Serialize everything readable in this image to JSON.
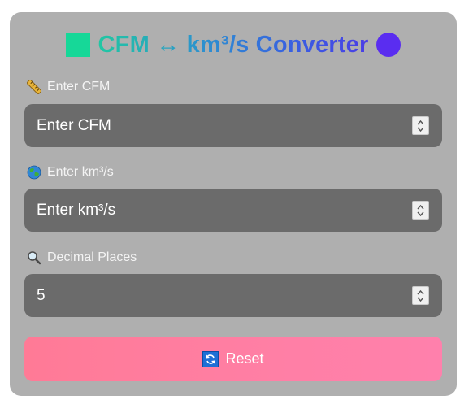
{
  "title": {
    "text": "CFM ↔ km³/s Converter",
    "left_icon": "green-square-icon",
    "right_icon": "purple-circle-icon"
  },
  "fields": [
    {
      "label": "Enter CFM",
      "icon": "ruler-icon",
      "placeholder": "Enter CFM",
      "value": ""
    },
    {
      "label": "Enter km³/s",
      "icon": "globe-icon",
      "placeholder": "Enter km³/s",
      "value": ""
    },
    {
      "label": "Decimal Places",
      "icon": "magnifier-icon",
      "placeholder": "",
      "value": "5"
    }
  ],
  "reset": {
    "label": "Reset",
    "icon": "refresh-icon"
  },
  "colors": {
    "card": "#afafaf",
    "input": "#6b6b6b",
    "reset_start": "#ff7a96",
    "reset_end": "#ff80ac",
    "title_start": "#21c7a3",
    "title_end": "#4a3ee6"
  }
}
